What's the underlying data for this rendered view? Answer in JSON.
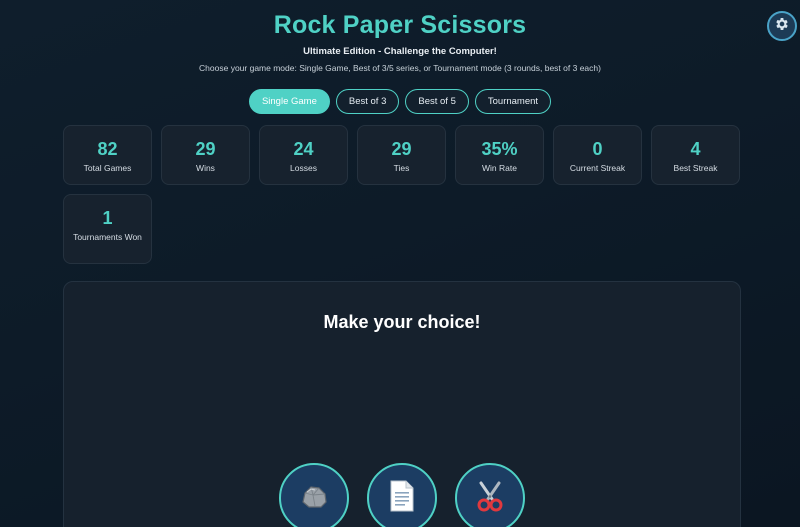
{
  "header": {
    "title": "Rock Paper Scissors",
    "subtitle": "Ultimate Edition - Challenge the Computer!",
    "description": "Choose your game mode: Single Game, Best of 3/5 series, or Tournament mode (3 rounds, best of 3 each)"
  },
  "settings": {
    "icon": "gear-icon"
  },
  "modes": [
    {
      "label": "Single Game",
      "active": true
    },
    {
      "label": "Best of 3",
      "active": false
    },
    {
      "label": "Best of 5",
      "active": false
    },
    {
      "label": "Tournament",
      "active": false
    }
  ],
  "stats": [
    {
      "value": "82",
      "label": "Total Games"
    },
    {
      "value": "29",
      "label": "Wins"
    },
    {
      "value": "24",
      "label": "Losses"
    },
    {
      "value": "29",
      "label": "Ties"
    },
    {
      "value": "35%",
      "label": "Win Rate"
    },
    {
      "value": "0",
      "label": "Current Streak"
    },
    {
      "value": "4",
      "label": "Best Streak"
    },
    {
      "value": "1",
      "label": "Tournaments Won"
    }
  ],
  "game": {
    "prompt": "Make your choice!",
    "choices": [
      {
        "name": "rock",
        "icon": "rock-icon"
      },
      {
        "name": "paper",
        "icon": "paper-icon"
      },
      {
        "name": "scissors",
        "icon": "scissors-icon"
      }
    ]
  },
  "colors": {
    "accent": "#4fd1c5",
    "background": "#0d1b28",
    "card": "#17222e",
    "choice_button": "#1c3d63"
  }
}
